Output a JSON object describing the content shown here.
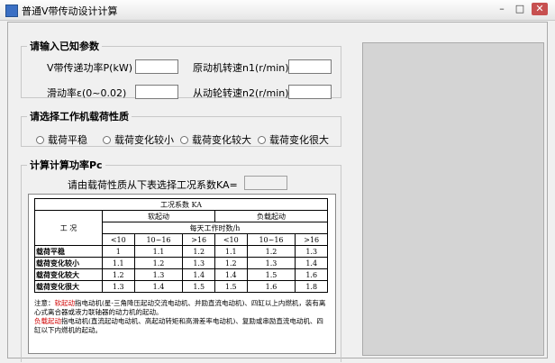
{
  "window": {
    "title": "普通V带传动设计计算"
  },
  "input_group": {
    "legend": "请输入已知参数",
    "power_label": "V带传递功率P(kW)",
    "n1_label": "原动机转速n1(r/min)",
    "slip_label": "滑动率ε(0~0.02)",
    "n2_label": "从动轮转速n2(r/min)"
  },
  "load_group": {
    "legend": "请选择工作机载荷性质",
    "options": [
      "载荷平稳",
      "载荷变化较小",
      "载荷变化较大",
      "载荷变化很大"
    ]
  },
  "power_group": {
    "legend": "计算计算功率Pc",
    "ka_prompt": "请由载荷性质从下表选择工况系数KA="
  },
  "ka_table": {
    "title": "工况系数 KA",
    "condition_header": "工  况",
    "soft_start": "软起动",
    "load_start": "负载起动",
    "hours_header": "每天工作时数/h",
    "hour_cols": [
      "<10",
      "10~16",
      ">16",
      "<10",
      "10~16",
      ">16"
    ],
    "rows": [
      {
        "label": "载荷平稳",
        "values": [
          "1",
          "1.1",
          "1.2",
          "1.1",
          "1.2",
          "1.3"
        ]
      },
      {
        "label": "载荷变化较小",
        "values": [
          "1.1",
          "1.2",
          "1.3",
          "1.2",
          "1.3",
          "1.4"
        ]
      },
      {
        "label": "载荷变化较大",
        "values": [
          "1.2",
          "1.3",
          "1.4",
          "1.4",
          "1.5",
          "1.6"
        ]
      },
      {
        "label": "载荷变化很大",
        "values": [
          "1.3",
          "1.4",
          "1.5",
          "1.5",
          "1.6",
          "1.8"
        ]
      }
    ],
    "note_prefix": "注意：",
    "note_soft_term": "软起动",
    "note_soft_text": "指电动机(星-三角降压起动交流电动机、并励直流电动机)、四缸以上内燃机，装有离心式离合器或液力联轴器的动力机的起动。",
    "note_load_term": "负载起动",
    "note_load_text": "指电动机(直流起动电动机、高起动转矩和高滑差率电动机)、复励或串励直流电动机、四缸以下内燃机的起动。"
  },
  "colors": {
    "close": "#c75050",
    "accent": "#3a6fc4",
    "note_red": "#d00000"
  }
}
